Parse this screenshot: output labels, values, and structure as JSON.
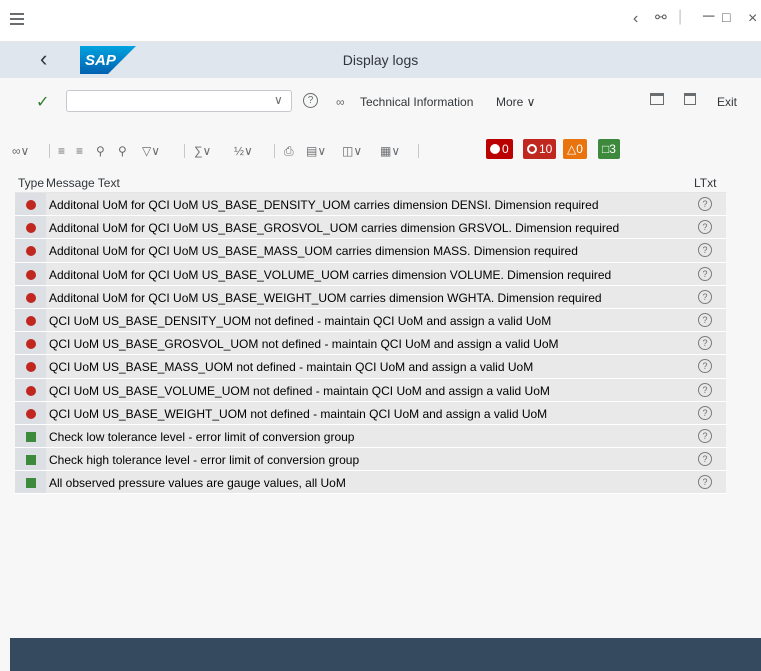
{
  "header": {
    "logo_text": "SAP",
    "title": "Display logs"
  },
  "toolbar": {
    "command_value": "",
    "technical_information": "Technical Information",
    "more": "More",
    "exit": "Exit"
  },
  "alv": {
    "counts": {
      "stop": "0",
      "error": "10",
      "warning": "0",
      "success": "3"
    }
  },
  "table": {
    "col_type": "Type",
    "col_message": "Message Text",
    "col_ltxt": "LTxt",
    "rows": [
      {
        "type": "error",
        "text": "Additonal UoM for QCI UoM US_BASE_DENSITY_UOM carries dimension DENSI. Dimension  required"
      },
      {
        "type": "error",
        "text": "Additonal UoM for QCI UoM US_BASE_GROSVOL_UOM carries dimension GRSVOL. Dimension  required"
      },
      {
        "type": "error",
        "text": "Additonal UoM for QCI UoM US_BASE_MASS_UOM carries dimension MASS. Dimension  required"
      },
      {
        "type": "error",
        "text": "Additonal UoM for QCI UoM US_BASE_VOLUME_UOM carries dimension VOLUME. Dimension  required"
      },
      {
        "type": "error",
        "text": "Additonal UoM for QCI UoM US_BASE_WEIGHT_UOM carries dimension WGHTA. Dimension  required"
      },
      {
        "type": "error",
        "text": "QCI UoM US_BASE_DENSITY_UOM not defined - maintain QCI UoM and assign a valid UoM"
      },
      {
        "type": "error",
        "text": "QCI UoM US_BASE_GROSVOL_UOM not defined - maintain QCI UoM and assign a valid UoM"
      },
      {
        "type": "error",
        "text": "QCI UoM US_BASE_MASS_UOM not defined - maintain QCI UoM and assign a valid UoM"
      },
      {
        "type": "error",
        "text": "QCI UoM US_BASE_VOLUME_UOM not defined - maintain QCI UoM and assign a valid UoM"
      },
      {
        "type": "error",
        "text": "QCI UoM US_BASE_WEIGHT_UOM not defined - maintain QCI UoM and assign a valid UoM"
      },
      {
        "type": "success",
        "text": "Check low tolerance level - error limit of conversion group"
      },
      {
        "type": "success",
        "text": "Check high tolerance level - error limit of conversion group"
      },
      {
        "type": "success",
        "text": "All observed pressure values are gauge values, all UoM"
      }
    ]
  },
  "colors": {
    "shell_header": "#dfe6ee",
    "error": "#c0271f",
    "success": "#3d8a3d",
    "warning": "#e9730c",
    "footer": "#354a5f"
  }
}
